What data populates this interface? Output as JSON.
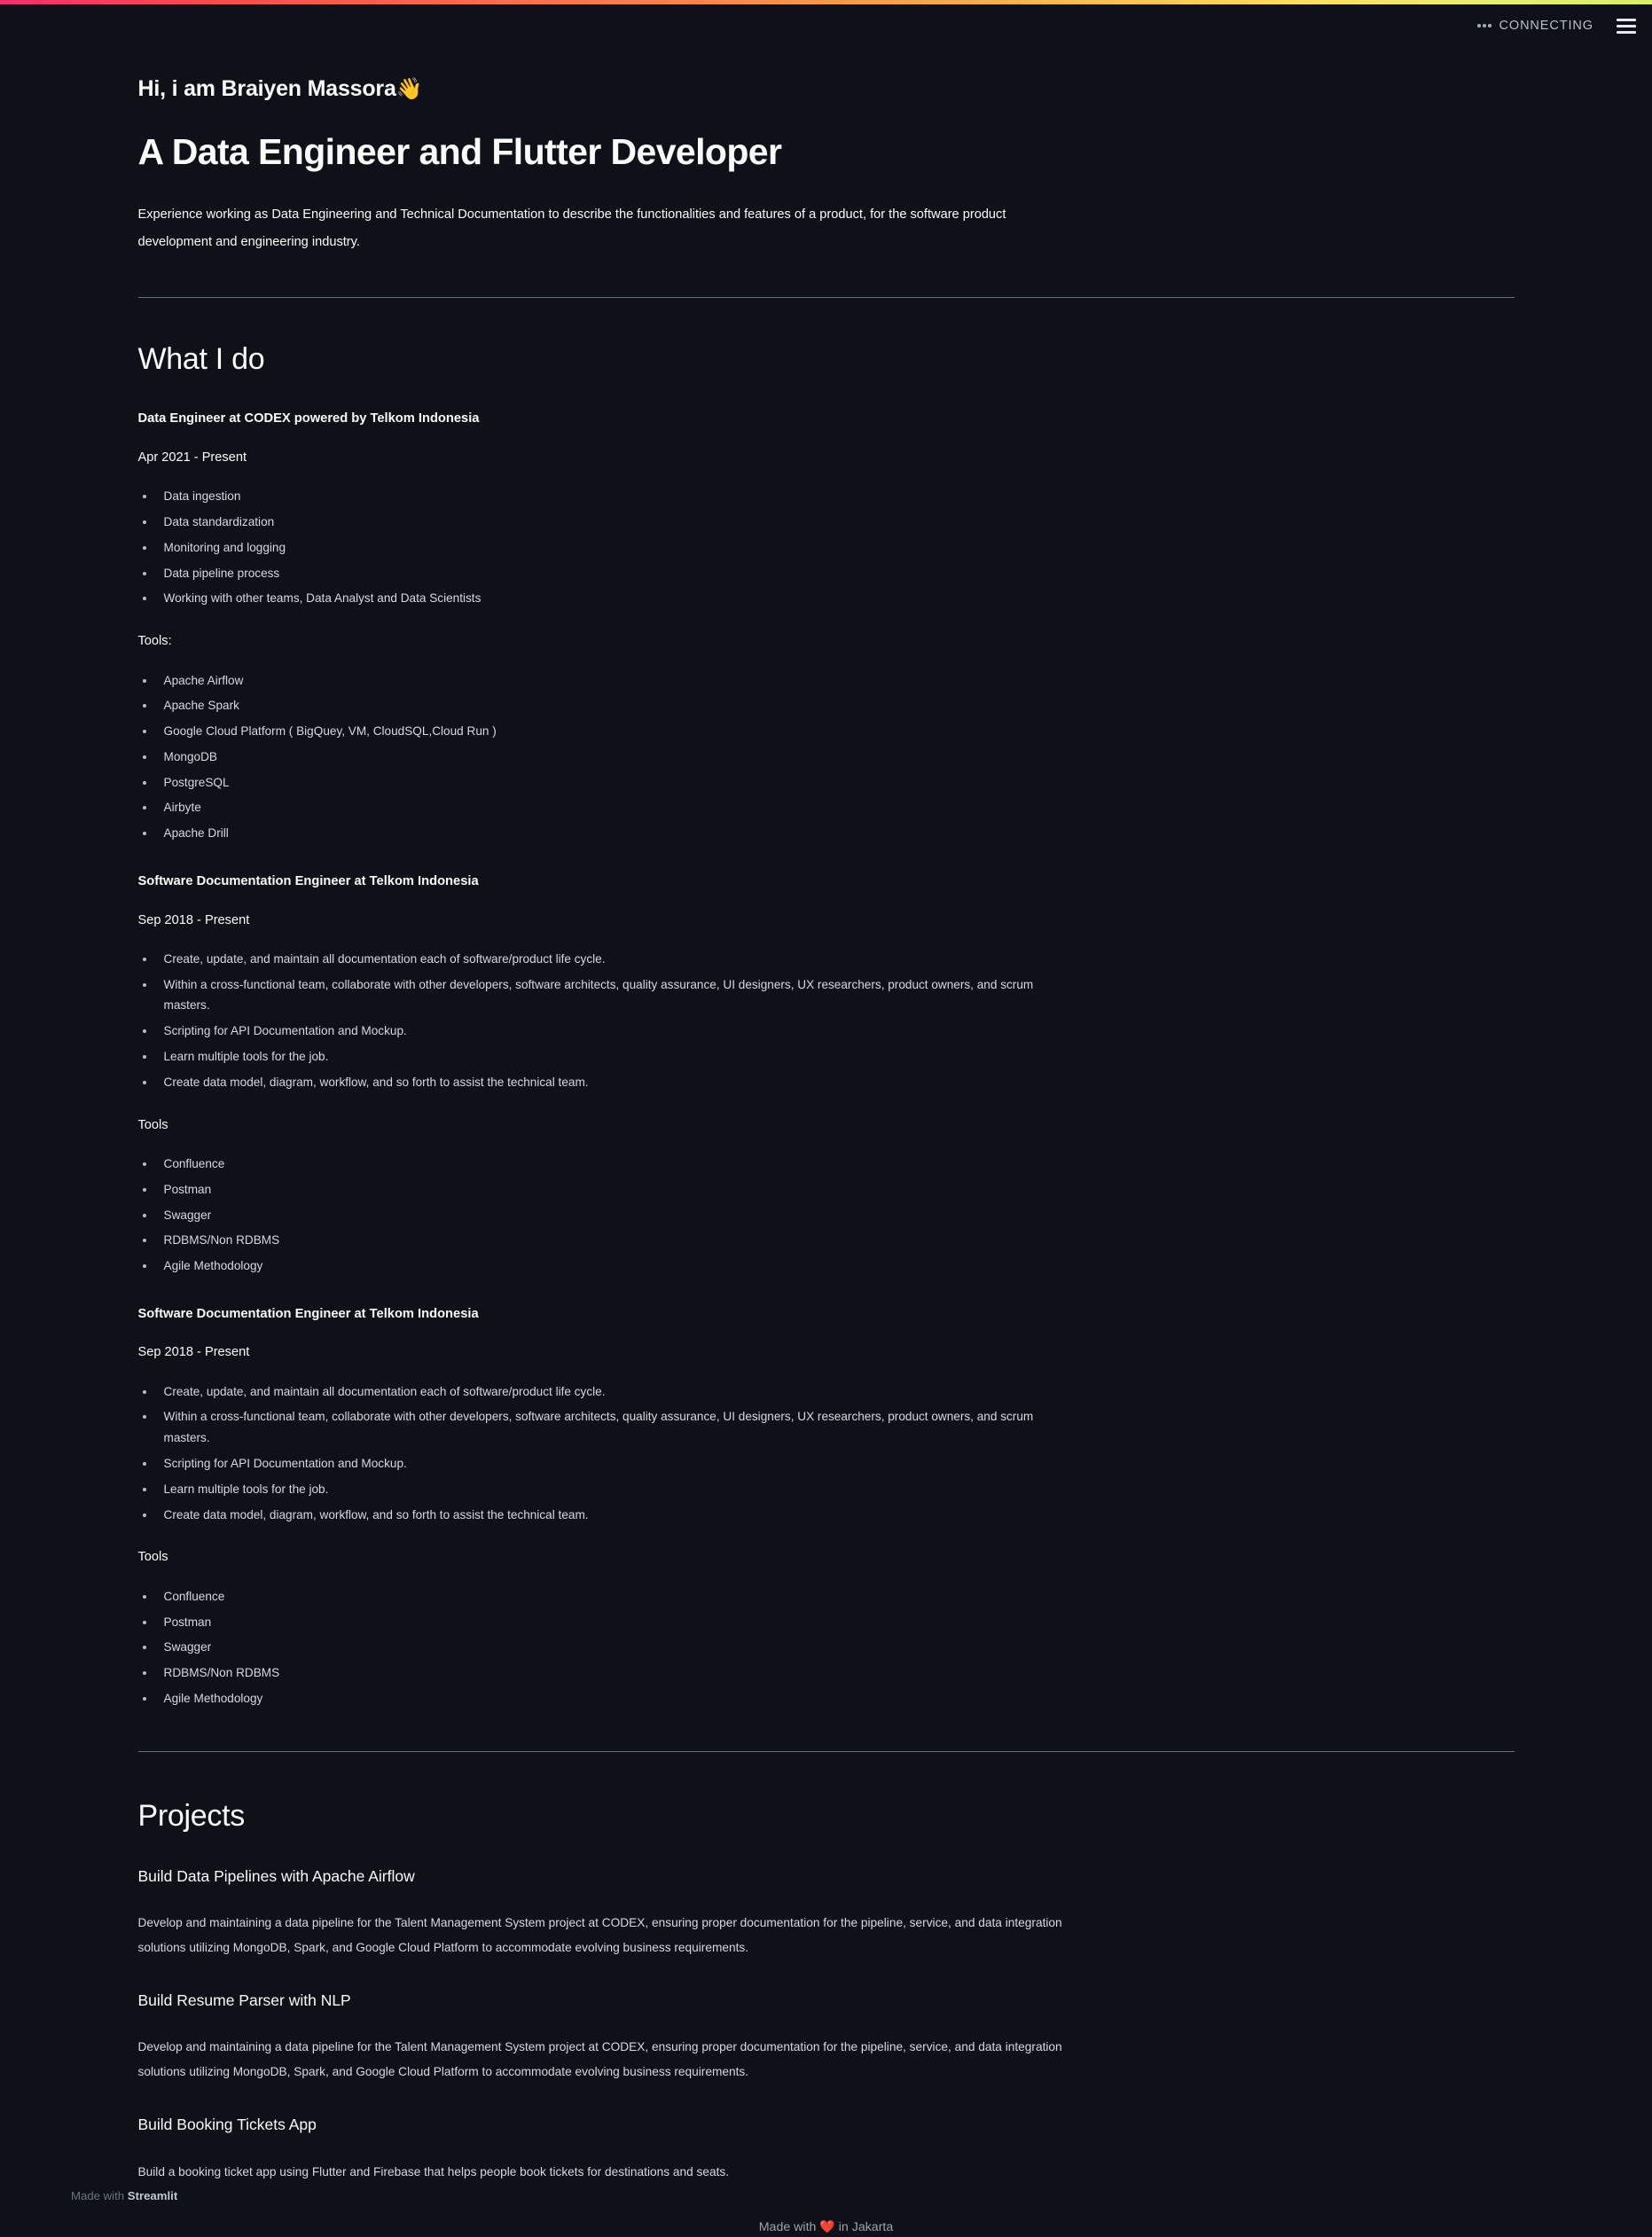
{
  "theme": {
    "background": "#0e1117",
    "text": "#fafafa",
    "muted": "#d6d9e0",
    "divider": "#7a8091",
    "gradient_start": "#ff2b6d",
    "gradient_mid": "#ff8c42",
    "gradient_end": "#d6ef5c",
    "heart": "#e03131"
  },
  "header": {
    "status_label": "CONNECTING",
    "running_icon": "running-dots-icon",
    "menu_icon": "hamburger-menu-icon"
  },
  "hero": {
    "greeting": "Hi, i am Braiyen Massora",
    "wave_emoji": "👋",
    "headline": "A Data Engineer and Flutter Developer",
    "intro": "Experience working as Data Engineering and Technical Documentation to describe the functionalities and features of a product, for the software product development and engineering industry."
  },
  "what_i_do": {
    "title": "What I do",
    "jobs": [
      {
        "title": "Data Engineer at CODEX powered by Telkom Indonesia",
        "date": "Apr 2021 - Present",
        "responsibilities": [
          "Data ingestion",
          "Data standardization",
          "Monitoring and logging",
          "Data pipeline process",
          "Working with other teams, Data Analyst and Data Scientists"
        ],
        "tools_label": "Tools:",
        "tools": [
          "Apache Airflow",
          "Apache Spark",
          "Google Cloud Platform ( BigQuey, VM, CloudSQL,Cloud Run )",
          "MongoDB",
          "PostgreSQL",
          "Airbyte",
          "Apache Drill"
        ]
      },
      {
        "title": "Software Documentation Engineer at Telkom Indonesia",
        "date": "Sep 2018 - Present",
        "responsibilities": [
          "Create, update, and maintain all documentation each of software/product life cycle.",
          "Within a cross-functional team, collaborate with other developers, software architects, quality assurance, UI designers, UX researchers, product owners, and scrum masters.",
          "Scripting for API Documentation and Mockup.",
          "Learn multiple tools for the job.",
          "Create data model, diagram, workflow, and so forth to assist the technical team."
        ],
        "tools_label": "Tools",
        "tools": [
          "Confluence",
          "Postman",
          "Swagger",
          "RDBMS/Non RDBMS",
          "Agile Methodology"
        ]
      },
      {
        "title": "Software Documentation Engineer at Telkom Indonesia",
        "date": "Sep 2018 - Present",
        "responsibilities": [
          "Create, update, and maintain all documentation each of software/product life cycle.",
          "Within a cross-functional team, collaborate with other developers, software architects, quality assurance, UI designers, UX researchers, product owners, and scrum masters.",
          "Scripting for API Documentation and Mockup.",
          "Learn multiple tools for the job.",
          "Create data model, diagram, workflow, and so forth to assist the technical team."
        ],
        "tools_label": "Tools",
        "tools": [
          "Confluence",
          "Postman",
          "Swagger",
          "RDBMS/Non RDBMS",
          "Agile Methodology"
        ]
      }
    ]
  },
  "projects": {
    "title": "Projects",
    "items": [
      {
        "title": "Build Data Pipelines with Apache Airflow",
        "description": "Develop and maintaining a data pipeline for the Talent Management System project at CODEX, ensuring proper documentation for the pipeline, service, and data integration solutions utilizing MongoDB, Spark, and Google Cloud Platform to accommodate evolving business requirements."
      },
      {
        "title": "Build Resume Parser with NLP",
        "description": "Develop and maintaining a data pipeline for the Talent Management System project at CODEX, ensuring proper documentation for the pipeline, service, and data integration solutions utilizing MongoDB, Spark, and Google Cloud Platform to accommodate evolving business requirements."
      },
      {
        "title": "Build Booking Tickets App",
        "description": "Build a booking ticket app using Flutter and Firebase that helps people book tickets for destinations and seats."
      }
    ]
  },
  "footer": {
    "made_with_prefix": "Made with",
    "heart_emoji": "❤️",
    "made_with_suffix": "in Jakarta"
  },
  "streamlit_footer": {
    "prefix": "Made with",
    "brand": "Streamlit"
  }
}
